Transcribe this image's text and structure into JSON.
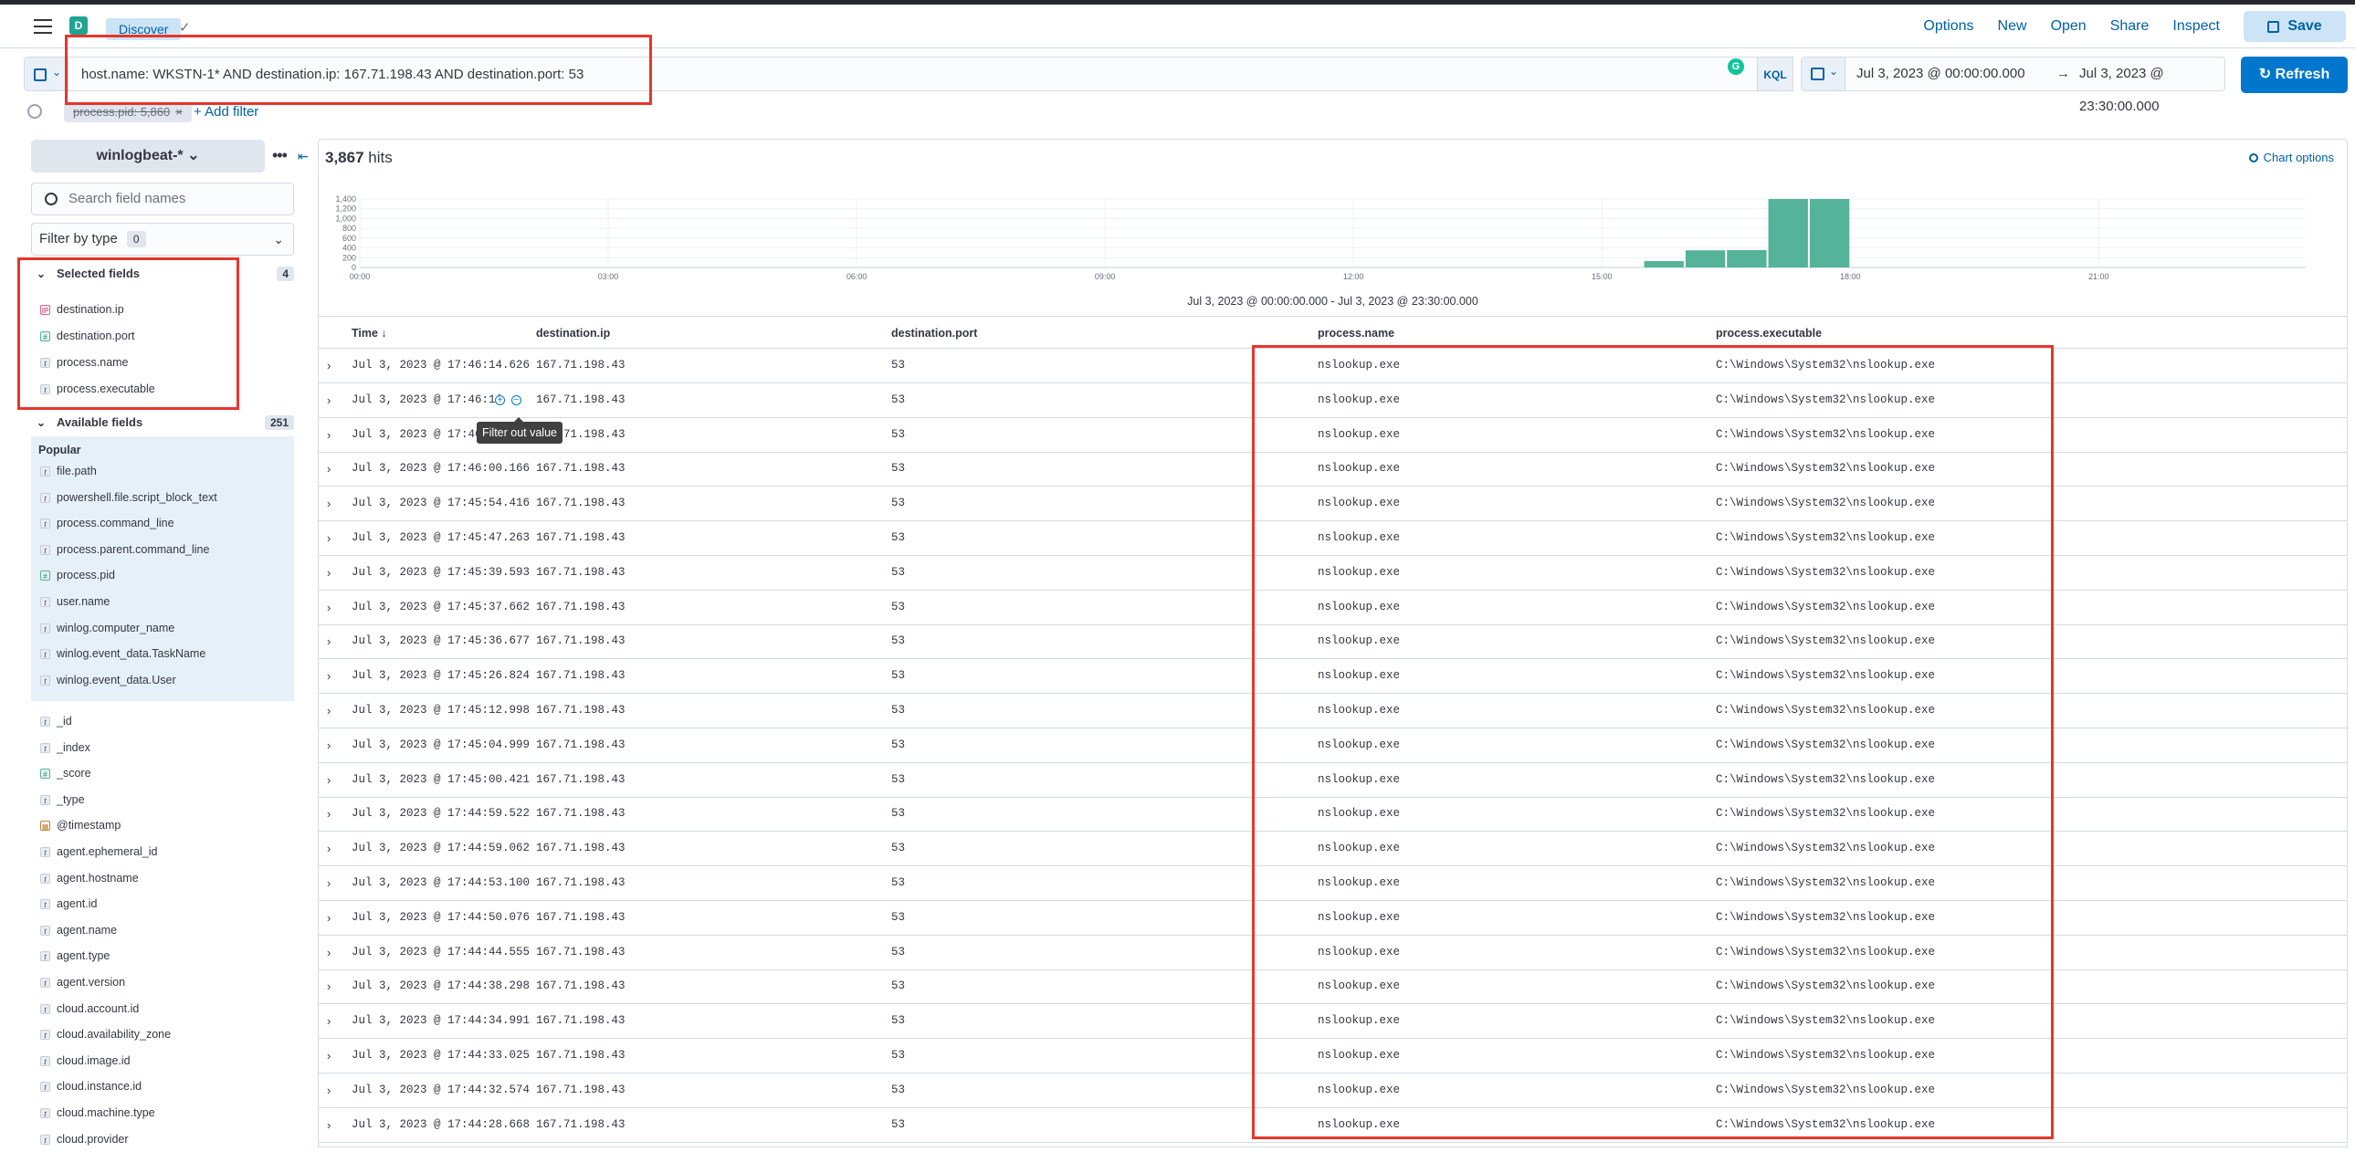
{
  "header": {
    "space_initial": "D",
    "breadcrumb": "Discover",
    "links": [
      "Options",
      "New",
      "Open",
      "Share",
      "Inspect"
    ],
    "save_label": "Save"
  },
  "query": {
    "text": "host.name: WKSTN-1* AND destination.ip: 167.71.198.43 AND destination.port: 53",
    "language": "KQL",
    "grammarly_letter": "G",
    "time_start": "Jul 3, 2023 @ 00:00:00.000",
    "time_arrow": "→",
    "time_end": "Jul 3, 2023 @ 23:30:00.000",
    "refresh_label": "Refresh"
  },
  "filters": {
    "pill": "process.pid: 5,860",
    "pill_close": "×",
    "add_filter": "+ Add filter"
  },
  "sidebar": {
    "index_pattern": "winlogbeat-*",
    "search_placeholder": "Search field names",
    "filter_by_type": "Filter by type",
    "filter_count": "0",
    "selected_title": "Selected fields",
    "selected_count": "4",
    "selected": [
      {
        "name": "destination.ip",
        "type": "ip",
        "glyph": "IP"
      },
      {
        "name": "destination.port",
        "type": "num",
        "glyph": "#"
      },
      {
        "name": "process.name",
        "type": "str",
        "glyph": "t"
      },
      {
        "name": "process.executable",
        "type": "str",
        "glyph": "t"
      }
    ],
    "available_title": "Available fields",
    "available_count": "251",
    "popular_label": "Popular",
    "popular": [
      {
        "name": "file.path",
        "type": "str",
        "glyph": "t"
      },
      {
        "name": "powershell.file.script_block_text",
        "type": "str",
        "glyph": "t"
      },
      {
        "name": "process.command_line",
        "type": "str",
        "glyph": "t"
      },
      {
        "name": "process.parent.command_line",
        "type": "str",
        "glyph": "t"
      },
      {
        "name": "process.pid",
        "type": "num",
        "glyph": "#"
      },
      {
        "name": "user.name",
        "type": "str",
        "glyph": "t"
      },
      {
        "name": "winlog.computer_name",
        "type": "str",
        "glyph": "t"
      },
      {
        "name": "winlog.event_data.TaskName",
        "type": "str",
        "glyph": "t"
      },
      {
        "name": "winlog.event_data.User",
        "type": "str",
        "glyph": "t"
      }
    ],
    "others": [
      {
        "name": "_id",
        "type": "str",
        "glyph": "t"
      },
      {
        "name": "_index",
        "type": "str",
        "glyph": "t"
      },
      {
        "name": "_score",
        "type": "num",
        "glyph": "#"
      },
      {
        "name": "_type",
        "type": "str",
        "glyph": "t"
      },
      {
        "name": "@timestamp",
        "type": "date",
        "glyph": "▦"
      },
      {
        "name": "agent.ephemeral_id",
        "type": "str",
        "glyph": "t"
      },
      {
        "name": "agent.hostname",
        "type": "str",
        "glyph": "t"
      },
      {
        "name": "agent.id",
        "type": "str",
        "glyph": "t"
      },
      {
        "name": "agent.name",
        "type": "str",
        "glyph": "t"
      },
      {
        "name": "agent.type",
        "type": "str",
        "glyph": "t"
      },
      {
        "name": "agent.version",
        "type": "str",
        "glyph": "t"
      },
      {
        "name": "cloud.account.id",
        "type": "str",
        "glyph": "t"
      },
      {
        "name": "cloud.availability_zone",
        "type": "str",
        "glyph": "t"
      },
      {
        "name": "cloud.image.id",
        "type": "str",
        "glyph": "t"
      },
      {
        "name": "cloud.instance.id",
        "type": "str",
        "glyph": "t"
      },
      {
        "name": "cloud.machine.type",
        "type": "str",
        "glyph": "t"
      },
      {
        "name": "cloud.provider",
        "type": "str",
        "glyph": "t"
      }
    ]
  },
  "results": {
    "hits": "3,867",
    "hits_suffix": "hits",
    "chart_options": "Chart options",
    "range_label": "Jul 3, 2023 @ 00:00:00.000 - Jul 3, 2023 @ 23:30:00.000",
    "columns": [
      "Time ↓",
      "destination.ip",
      "destination.port",
      "process.name",
      "process.executable"
    ],
    "tooltip": "Filter out value",
    "cell_actions": [
      "+",
      "−"
    ],
    "rows": [
      {
        "time": "Jul 3, 2023 @ 17:46:14.626",
        "ip": "167.71.198.43",
        "port": "53",
        "pname": "nslookup.exe",
        "exe": "C:\\Windows\\System32\\nslookup.exe"
      },
      {
        "time": "Jul 3, 2023 @ 17:46:1(",
        "ip": "167.71.198.43",
        "port": "53",
        "pname": "nslookup.exe",
        "exe": "C:\\Windows\\System32\\nslookup.exe"
      },
      {
        "time": "Jul 3, 2023 @ 17:46",
        "ip": "167.71.198.43",
        "port": "53",
        "pname": "nslookup.exe",
        "exe": "C:\\Windows\\System32\\nslookup.exe"
      },
      {
        "time": "Jul 3, 2023 @ 17:46:00.166",
        "ip": "167.71.198.43",
        "port": "53",
        "pname": "nslookup.exe",
        "exe": "C:\\Windows\\System32\\nslookup.exe"
      },
      {
        "time": "Jul 3, 2023 @ 17:45:54.416",
        "ip": "167.71.198.43",
        "port": "53",
        "pname": "nslookup.exe",
        "exe": "C:\\Windows\\System32\\nslookup.exe"
      },
      {
        "time": "Jul 3, 2023 @ 17:45:47.263",
        "ip": "167.71.198.43",
        "port": "53",
        "pname": "nslookup.exe",
        "exe": "C:\\Windows\\System32\\nslookup.exe"
      },
      {
        "time": "Jul 3, 2023 @ 17:45:39.593",
        "ip": "167.71.198.43",
        "port": "53",
        "pname": "nslookup.exe",
        "exe": "C:\\Windows\\System32\\nslookup.exe"
      },
      {
        "time": "Jul 3, 2023 @ 17:45:37.662",
        "ip": "167.71.198.43",
        "port": "53",
        "pname": "nslookup.exe",
        "exe": "C:\\Windows\\System32\\nslookup.exe"
      },
      {
        "time": "Jul 3, 2023 @ 17:45:36.677",
        "ip": "167.71.198.43",
        "port": "53",
        "pname": "nslookup.exe",
        "exe": "C:\\Windows\\System32\\nslookup.exe"
      },
      {
        "time": "Jul 3, 2023 @ 17:45:26.824",
        "ip": "167.71.198.43",
        "port": "53",
        "pname": "nslookup.exe",
        "exe": "C:\\Windows\\System32\\nslookup.exe"
      },
      {
        "time": "Jul 3, 2023 @ 17:45:12.998",
        "ip": "167.71.198.43",
        "port": "53",
        "pname": "nslookup.exe",
        "exe": "C:\\Windows\\System32\\nslookup.exe"
      },
      {
        "time": "Jul 3, 2023 @ 17:45:04.999",
        "ip": "167.71.198.43",
        "port": "53",
        "pname": "nslookup.exe",
        "exe": "C:\\Windows\\System32\\nslookup.exe"
      },
      {
        "time": "Jul 3, 2023 @ 17:45:00.421",
        "ip": "167.71.198.43",
        "port": "53",
        "pname": "nslookup.exe",
        "exe": "C:\\Windows\\System32\\nslookup.exe"
      },
      {
        "time": "Jul 3, 2023 @ 17:44:59.522",
        "ip": "167.71.198.43",
        "port": "53",
        "pname": "nslookup.exe",
        "exe": "C:\\Windows\\System32\\nslookup.exe"
      },
      {
        "time": "Jul 3, 2023 @ 17:44:59.062",
        "ip": "167.71.198.43",
        "port": "53",
        "pname": "nslookup.exe",
        "exe": "C:\\Windows\\System32\\nslookup.exe"
      },
      {
        "time": "Jul 3, 2023 @ 17:44:53.100",
        "ip": "167.71.198.43",
        "port": "53",
        "pname": "nslookup.exe",
        "exe": "C:\\Windows\\System32\\nslookup.exe"
      },
      {
        "time": "Jul 3, 2023 @ 17:44:50.076",
        "ip": "167.71.198.43",
        "port": "53",
        "pname": "nslookup.exe",
        "exe": "C:\\Windows\\System32\\nslookup.exe"
      },
      {
        "time": "Jul 3, 2023 @ 17:44:44.555",
        "ip": "167.71.198.43",
        "port": "53",
        "pname": "nslookup.exe",
        "exe": "C:\\Windows\\System32\\nslookup.exe"
      },
      {
        "time": "Jul 3, 2023 @ 17:44:38.298",
        "ip": "167.71.198.43",
        "port": "53",
        "pname": "nslookup.exe",
        "exe": "C:\\Windows\\System32\\nslookup.exe"
      },
      {
        "time": "Jul 3, 2023 @ 17:44:34.991",
        "ip": "167.71.198.43",
        "port": "53",
        "pname": "nslookup.exe",
        "exe": "C:\\Windows\\System32\\nslookup.exe"
      },
      {
        "time": "Jul 3, 2023 @ 17:44:33.025",
        "ip": "167.71.198.43",
        "port": "53",
        "pname": "nslookup.exe",
        "exe": "C:\\Windows\\System32\\nslookup.exe"
      },
      {
        "time": "Jul 3, 2023 @ 17:44:32.574",
        "ip": "167.71.198.43",
        "port": "53",
        "pname": "nslookup.exe",
        "exe": "C:\\Windows\\System32\\nslookup.exe"
      },
      {
        "time": "Jul 3, 2023 @ 17:44:28.668",
        "ip": "167.71.198.43",
        "port": "53",
        "pname": "nslookup.exe",
        "exe": "C:\\Windows\\System32\\nslookup.exe"
      }
    ]
  },
  "chart_data": {
    "type": "bar",
    "x_tick_labels": [
      "00:00",
      "03:00",
      "06:00",
      "09:00",
      "12:00",
      "15:00",
      "18:00",
      "21:00"
    ],
    "y_tick_labels": [
      "1,400",
      "1,200",
      "1,000",
      "800",
      "600",
      "400",
      "200",
      "0"
    ],
    "ylim": [
      0,
      1400
    ],
    "x_domain_hours": [
      0,
      23.5
    ],
    "bar_width_hours": 0.5,
    "bars": [
      {
        "start_hour": 15.5,
        "value": 130
      },
      {
        "start_hour": 16.0,
        "value": 350
      },
      {
        "start_hour": 16.5,
        "value": 355
      },
      {
        "start_hour": 17.0,
        "value": 1400
      },
      {
        "start_hour": 17.5,
        "value": 1400
      }
    ],
    "bar_color": "#54b399",
    "grid": true
  }
}
